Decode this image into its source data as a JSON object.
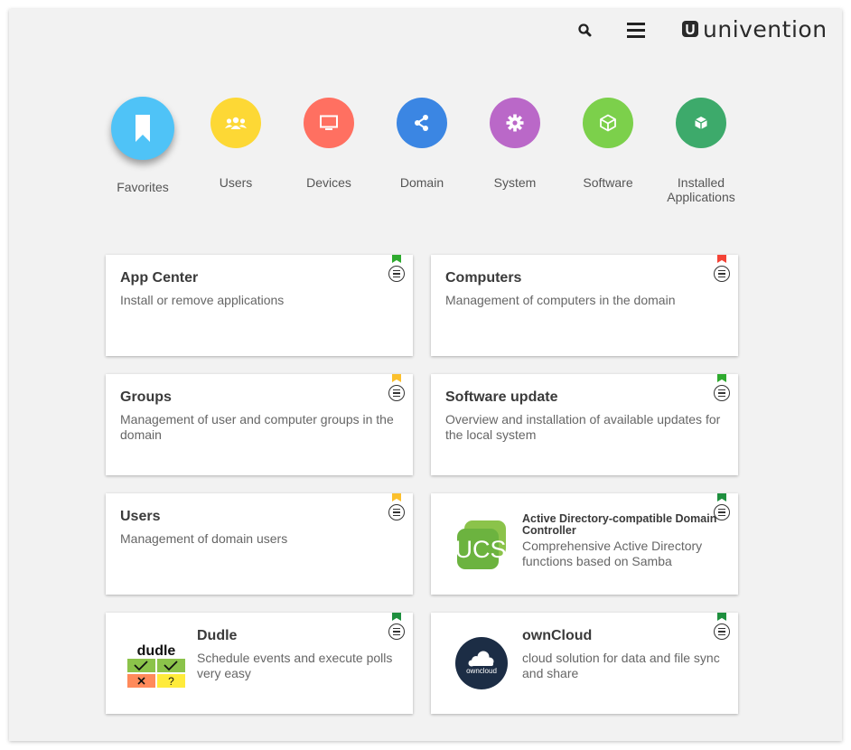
{
  "header": {
    "brand": "univention",
    "search_icon": "search-icon",
    "menu_icon": "hamburger-menu-icon"
  },
  "categories": [
    {
      "label": "Favorites",
      "icon": "bookmark-icon",
      "color": "#4fc3f7",
      "active": true
    },
    {
      "label": "Users",
      "icon": "users-icon",
      "color": "#fdd835"
    },
    {
      "label": "Devices",
      "icon": "monitor-icon",
      "color": "#ff7061"
    },
    {
      "label": "Domain",
      "icon": "share-nodes-icon",
      "color": "#3b86e3"
    },
    {
      "label": "System",
      "icon": "gear-icon",
      "color": "#ba68c8"
    },
    {
      "label": "Software",
      "icon": "cube-icon",
      "color": "#7cd04b"
    },
    {
      "label": "Installed Applications",
      "icon": "box-icon",
      "color": "#3daa6b"
    }
  ],
  "modules": [
    {
      "title": "App Center",
      "description": "Install or remove applications",
      "flag_color": "#2eaa2e"
    },
    {
      "title": "Computers",
      "description": "Management of computers in the domain",
      "flag_color": "#f44336"
    },
    {
      "title": "Groups",
      "description": "Management of user and computer groups in the domain",
      "flag_color": "#fbc02d"
    },
    {
      "title": "Software update",
      "description": "Overview and installation of available updates for the local system",
      "flag_color": "#2eaa2e"
    },
    {
      "title": "Users",
      "description": "Management of domain users",
      "flag_color": "#fbc02d"
    },
    {
      "title": "Active Directory-compatible Domain Controller",
      "description": "Comprehensive Active Directory functions based on Samba",
      "flag_color": "#1e8f3e",
      "logo": "ucs-logo",
      "logo_text": "UCS"
    },
    {
      "title": "Dudle",
      "description": "Schedule events and execute polls very easy",
      "flag_color": "#1e8f3e",
      "logo": "dudle-logo",
      "logo_text": "dudle"
    },
    {
      "title": "ownCloud",
      "description": "cloud solution for data and file sync and share",
      "flag_color": "#1e8f3e",
      "logo": "owncloud-logo",
      "logo_text": "owncloud"
    }
  ]
}
